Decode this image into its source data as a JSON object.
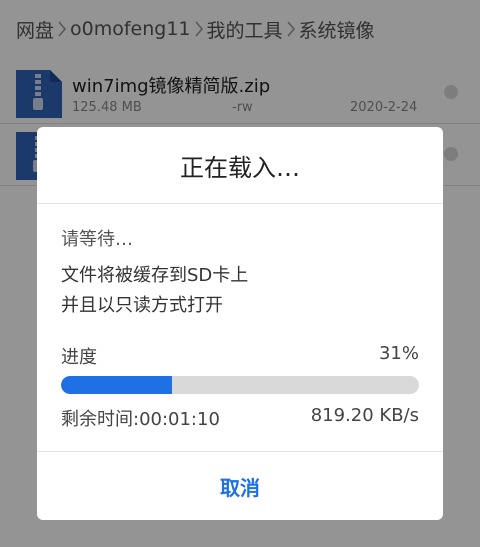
{
  "breadcrumb": [
    "网盘",
    "o0mofeng11",
    "我的工具",
    "系统镜像"
  ],
  "files": [
    {
      "name": "win7img镜像精简版.zip",
      "size": "125.48 MB",
      "perm": "-rw",
      "date": "2020-2-24",
      "icon": "zip-file-icon"
    },
    {
      "name": "",
      "size": "",
      "perm": "",
      "date": "",
      "icon": "zip-file-icon"
    }
  ],
  "dialog": {
    "title": "正在载入…",
    "wait_text": "请等待…",
    "line1": "文件将被缓存到SD卡上",
    "line2": "并且以只读方式打开",
    "progress_label": "进度",
    "progress_percent_text": "31%",
    "progress_value": 0.31,
    "remaining_time": "剩余时间:00:01:10",
    "speed": "819.20 KB/s",
    "cancel_label": "取消"
  },
  "colors": {
    "accent": "#1f6fe5",
    "file_icon": "#2f63b8",
    "overlay": "rgba(0,0,0,0.42)"
  }
}
